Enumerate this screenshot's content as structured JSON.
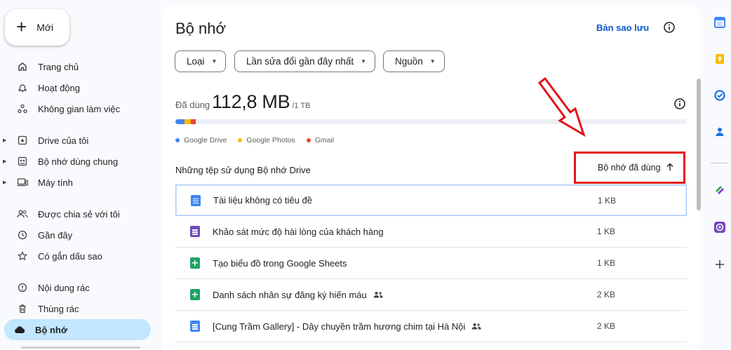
{
  "sidebar": {
    "new_button": "Mới",
    "items": [
      {
        "label": "Trang chủ"
      },
      {
        "label": "Hoạt động"
      },
      {
        "label": "Không gian làm việc"
      },
      {
        "label": "Drive của tôi"
      },
      {
        "label": "Bộ nhớ dùng chung"
      },
      {
        "label": "Máy tính"
      },
      {
        "label": "Được chia sẻ với tôi"
      },
      {
        "label": "Gần đây"
      },
      {
        "label": "Có gắn dấu sao"
      },
      {
        "label": "Nội dung rác"
      },
      {
        "label": "Thùng rác"
      },
      {
        "label": "Bộ nhớ"
      }
    ]
  },
  "main": {
    "title": "Bộ nhớ",
    "backup_link": "Bản sao lưu",
    "filters": {
      "type": "Loại",
      "modified": "Lần sửa đổi gần đây nhất",
      "source": "Nguồn"
    },
    "usage": {
      "used_label": "Đã dùng",
      "used_value": "112,8 MB",
      "capacity": "/1 TB"
    },
    "storage_bar": {
      "segments": [
        {
          "service": "Google Drive",
          "color": "#4285f4"
        },
        {
          "service": "Google Photos",
          "color": "#fbbc04"
        },
        {
          "service": "Gmail",
          "color": "#ea4335"
        }
      ]
    },
    "legend": [
      {
        "label": "Google Drive",
        "color": "#4285f4"
      },
      {
        "label": "Google Photos",
        "color": "#fbbc04"
      },
      {
        "label": "Gmail",
        "color": "#ea4335"
      }
    ],
    "files_heading": "Những tệp sử dụng Bộ nhớ Drive",
    "sort_column": "Bộ nhớ đã dùng",
    "files": [
      {
        "name": "Tài liệu không có tiêu đề",
        "type": "doc",
        "size": "1 KB",
        "shared": false
      },
      {
        "name": "Khảo sát mức độ hài lòng của khách hàng",
        "type": "form",
        "size": "1 KB",
        "shared": false
      },
      {
        "name": "Tạo biểu đồ trong Google Sheets",
        "type": "sheet",
        "size": "1 KB",
        "shared": false
      },
      {
        "name": "Danh sách nhân sự đăng ký hiến máu",
        "type": "sheet",
        "size": "2 KB",
        "shared": true
      },
      {
        "name": "[Cung Trầm Gallery] - Dây chuyền trầm hương chim tại Hà Nội",
        "type": "doc",
        "size": "2 KB",
        "shared": true
      }
    ]
  },
  "side_panel": {
    "icons": [
      "calendar-icon",
      "keep-icon",
      "tasks-icon",
      "contacts-icon",
      "addon-icon",
      "addon-purple-icon",
      "add-icon"
    ]
  }
}
